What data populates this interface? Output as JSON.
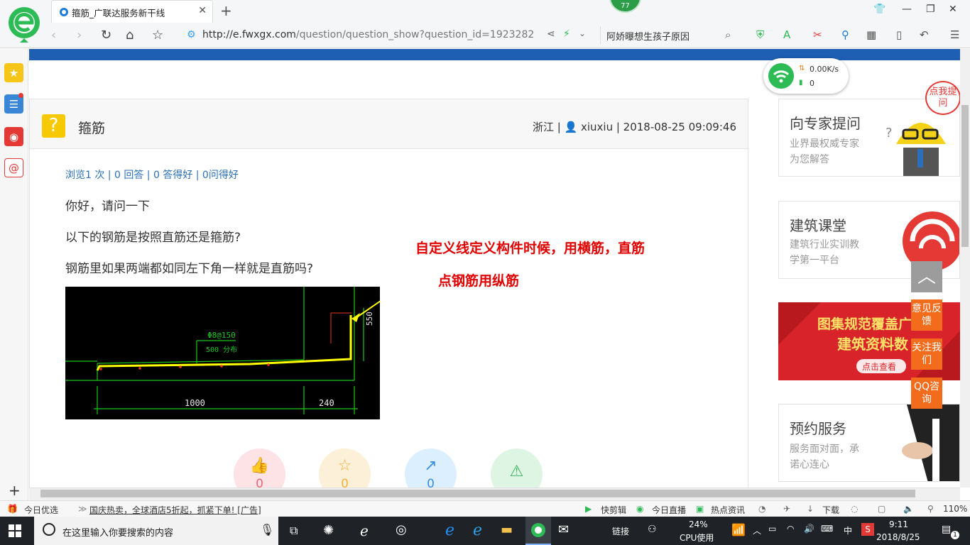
{
  "browser": {
    "tab_title": "箍筋_广联达服务新干线",
    "url_host": "http://e.fwxgx.com",
    "url_path": "/question/question_show?question_id=1923282",
    "search_value": "阿娇曝想生孩子原因",
    "badge_count": "77"
  },
  "net_widget": {
    "speed": "0.00K/s",
    "count": "0"
  },
  "question": {
    "title": "箍筋",
    "meta": "浙江 | 👤 xiuxiu | 2018-08-25 09:09:46",
    "stats": "浏览1 次 | 0 回答 | 0 答得好 | 0问得好",
    "p1": "你好，请问一下",
    "p2": "以下的钢筋是按照直筋还是箍筋?",
    "p3": "钢筋里如果两端都如同左下角一样就是直筋吗?",
    "annotation1": "自定义线定义构件时候，用横筋，直筋",
    "annotation2": "点钢筋用纵筋",
    "cad": {
      "label1": "Φ8@150",
      "label2": "500 分布",
      "dim1": "1000",
      "dim2": "240",
      "dim3": "550"
    },
    "actions": [
      {
        "name": "like",
        "count": "0",
        "color": "#fde3e6",
        "fg": "#e8687a"
      },
      {
        "name": "favorite",
        "count": "0",
        "color": "#fdf0d8",
        "fg": "#f2b13c"
      },
      {
        "name": "share",
        "count": "0",
        "color": "#dcefff",
        "fg": "#3a8ee6"
      },
      {
        "name": "report",
        "count": "",
        "color": "#dff5e4",
        "fg": "#3cb35a"
      }
    ]
  },
  "sidebar": {
    "card1": {
      "title": "向专家提问",
      "line1": "业界最权威专家",
      "line2": "为您解答",
      "bubble": "点我提问"
    },
    "card2": {
      "title": "建筑课堂",
      "line1": "建筑行业实训教",
      "line2": "学第一平台"
    },
    "promo": {
      "line1": "图集规范覆盖广",
      "line2": "建筑资料数",
      "cta": "点击查看"
    },
    "card3": {
      "title": "预约服务",
      "line1": "服务面对面，承",
      "line2": "诺心连心"
    }
  },
  "float_buttons": {
    "feedback": "意见反馈",
    "follow": "关注我们",
    "qq": "QQ咨询"
  },
  "status_bar": {
    "today": "今日优选",
    "ad": "国庆热卖，全球酒店5折起，抓紧下单! [广告]",
    "items": [
      "快剪辑",
      "今日直播",
      "热点资讯",
      "下载"
    ],
    "zoom": "110%"
  },
  "taskbar": {
    "search_placeholder": "在这里输入你要搜索的内容",
    "link_label": "链接",
    "cpu_pct": "24%",
    "cpu_label": "CPU使用",
    "ime": "中",
    "time": "9:11",
    "date": "2018/8/25",
    "notify_count": "1"
  }
}
